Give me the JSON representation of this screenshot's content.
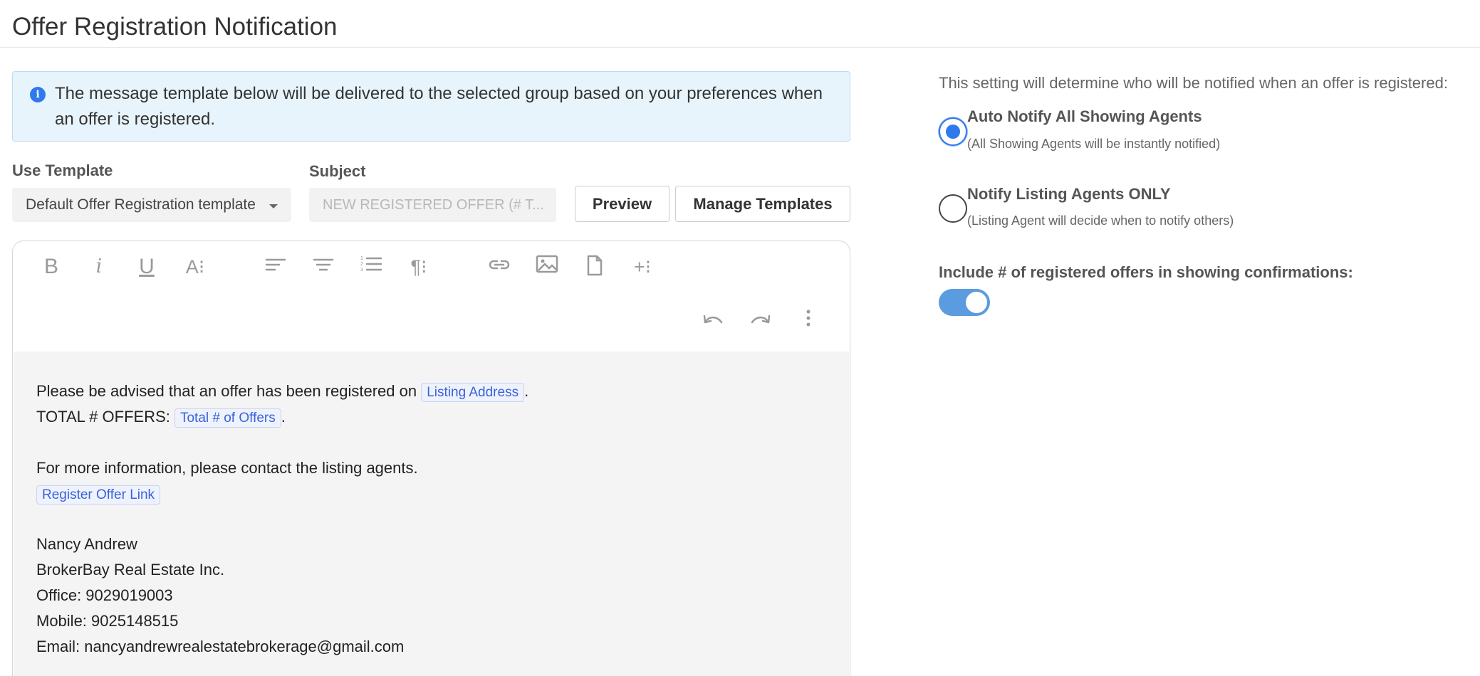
{
  "page": {
    "title": "Offer Registration Notification"
  },
  "info": {
    "text": "The message template below will be delivered to the selected group based on your preferences when an offer is registered.",
    "icon": "info-icon",
    "color": "#2f79ee"
  },
  "form": {
    "template_label": "Use Template",
    "template_value": "Default Offer Registration template",
    "subject_label": "Subject",
    "subject_placeholder": "NEW REGISTERED OFFER (# T..."
  },
  "buttons": {
    "preview": "Preview",
    "manage_templates": "Manage Templates"
  },
  "toolbar": {
    "bold": "B",
    "italic": "i",
    "underline": "U",
    "font_size": "A⁝",
    "paragraph": "¶⁝",
    "more": "+⁝"
  },
  "editor": {
    "line1_prefix": "Please be advised that an offer has been registered on",
    "chip_listing_address": "Listing Address",
    "line1_suffix": ".",
    "line2_prefix": "TOTAL # OFFERS:",
    "chip_total_offers": "Total # of Offers",
    "line2_suffix": ".",
    "line3": "For more information, please contact the listing agents.",
    "chip_register_link": "Register Offer Link",
    "signature": [
      "Nancy Andrew",
      "BrokerBay Real Estate Inc.",
      "Office: 9029019003",
      "Mobile: 9025148515",
      "Email: nancyandrewrealestatebrokerage@gmail.com"
    ]
  },
  "settings": {
    "description": "This setting will determine who will be notified when an offer is registered:",
    "options": [
      {
        "title": "Auto Notify All Showing Agents",
        "subtitle": "(All Showing Agents will be instantly notified)",
        "checked": true
      },
      {
        "title": "Notify Listing Agents ONLY",
        "subtitle": "(Listing Agent will decide when to notify others)",
        "checked": false
      }
    ],
    "toggle_label": "Include # of registered offers in showing confirmations:",
    "toggle_on": true,
    "accent_color": "#2f79ee"
  }
}
